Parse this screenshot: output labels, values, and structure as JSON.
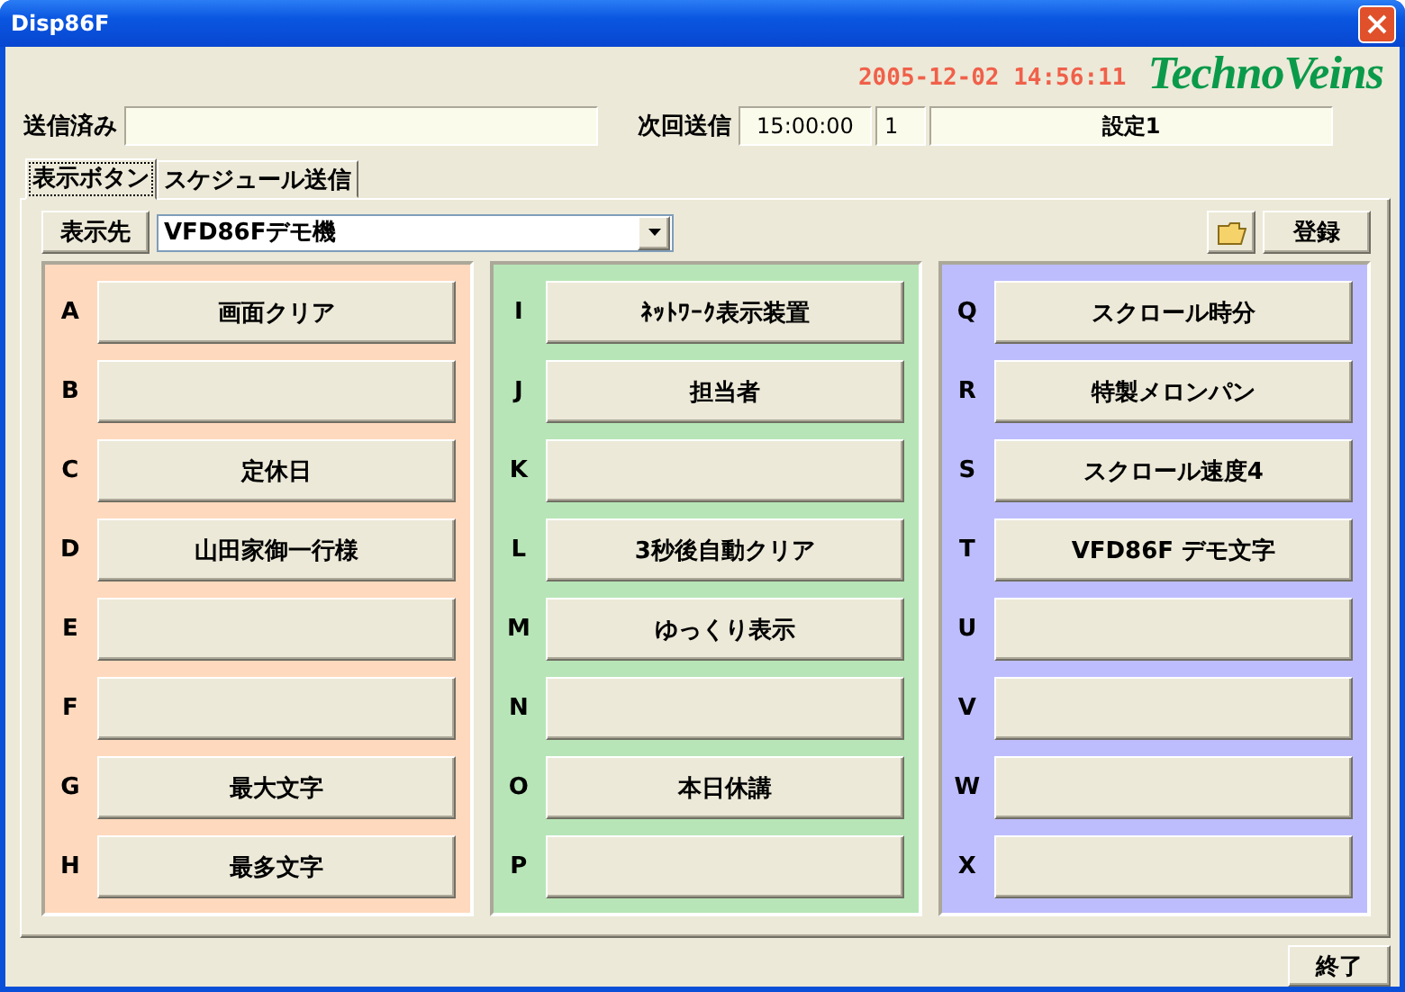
{
  "window": {
    "title": "Disp86F"
  },
  "timestamp": "2005-12-02  14:56:11",
  "logo": "TechnoVeins",
  "sent": {
    "label": "送信済み"
  },
  "next_send": {
    "label": "次回送信",
    "time": "15:00:00",
    "count": "1",
    "setting": "設定1"
  },
  "tabs": [
    {
      "label": "表示ボタン",
      "selected": true
    },
    {
      "label": "スケジュール送信",
      "selected": false
    }
  ],
  "target": {
    "button": "表示先",
    "value": "VFD86Fデモ機"
  },
  "register_button": "登録",
  "groups": [
    {
      "color": "#ffd9bd",
      "buttons": [
        {
          "key": "A",
          "label": "画面クリア"
        },
        {
          "key": "B"
        },
        {
          "key": "C",
          "label": "定休日"
        },
        {
          "key": "D",
          "label": "山田家御一行様"
        },
        {
          "key": "E"
        },
        {
          "key": "F"
        },
        {
          "key": "G",
          "label": "最大文字"
        },
        {
          "key": "H",
          "label": "最多文字"
        }
      ]
    },
    {
      "color": "#b7e5b7",
      "buttons": [
        {
          "key": "I",
          "label": "ﾈｯﾄﾜｰｸ表示装置"
        },
        {
          "key": "J",
          "label": "担当者"
        },
        {
          "key": "K"
        },
        {
          "key": "L",
          "label": "3秒後自動クリア"
        },
        {
          "key": "M",
          "label": "ゆっくり表示"
        },
        {
          "key": "N"
        },
        {
          "key": "O",
          "label": "本日休講"
        },
        {
          "key": "P"
        }
      ]
    },
    {
      "color": "#bdbdfd",
      "buttons": [
        {
          "key": "Q",
          "label": "スクロール時分"
        },
        {
          "key": "R",
          "label": "特製メロンパン"
        },
        {
          "key": "S",
          "label": "スクロール速度4"
        },
        {
          "key": "T",
          "label": "VFD86F デモ文字"
        },
        {
          "key": "U"
        },
        {
          "key": "V"
        },
        {
          "key": "W"
        },
        {
          "key": "X"
        }
      ]
    }
  ],
  "exit_button": "終了"
}
